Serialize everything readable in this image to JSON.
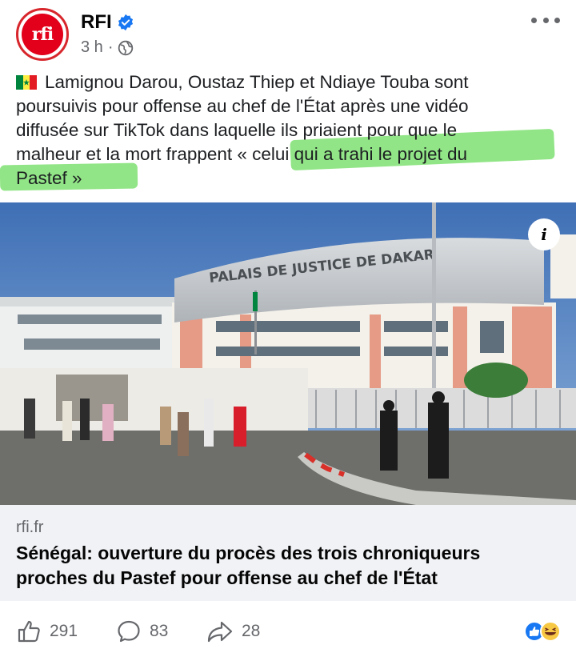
{
  "post": {
    "page_name": "RFI",
    "avatar_text": "rfi",
    "time": "3 h",
    "separator": "·",
    "text_line1": "Lamignou Darou, Oustaz Thiep et Ndiaye Touba sont",
    "text_line2": "poursuivis pour offense au chef de l'État après une vidéo",
    "text_line3": "diffusée sur TikTok dans laquelle ils priaient pour que le",
    "text_line4": "malheur et la mort frappent « celui qui a trahi le projet du",
    "text_line5": "Pastef »",
    "highlight_color": "#7fe072"
  },
  "photo": {
    "building_sign": "PALAIS DE JUSTICE DE DAKAR",
    "info_label": "i"
  },
  "link": {
    "domain": "rfi.fr",
    "headline_line1": "Sénégal: ouverture du procès des trois chroniqueurs",
    "headline_line2": "proches du Pastef pour offense au chef de l'État"
  },
  "footer": {
    "likes": "291",
    "comments": "83",
    "shares": "28"
  },
  "colors": {
    "brand_red": "#e2001a",
    "verified_blue": "#1877f2",
    "secondary_text": "#65676b"
  }
}
